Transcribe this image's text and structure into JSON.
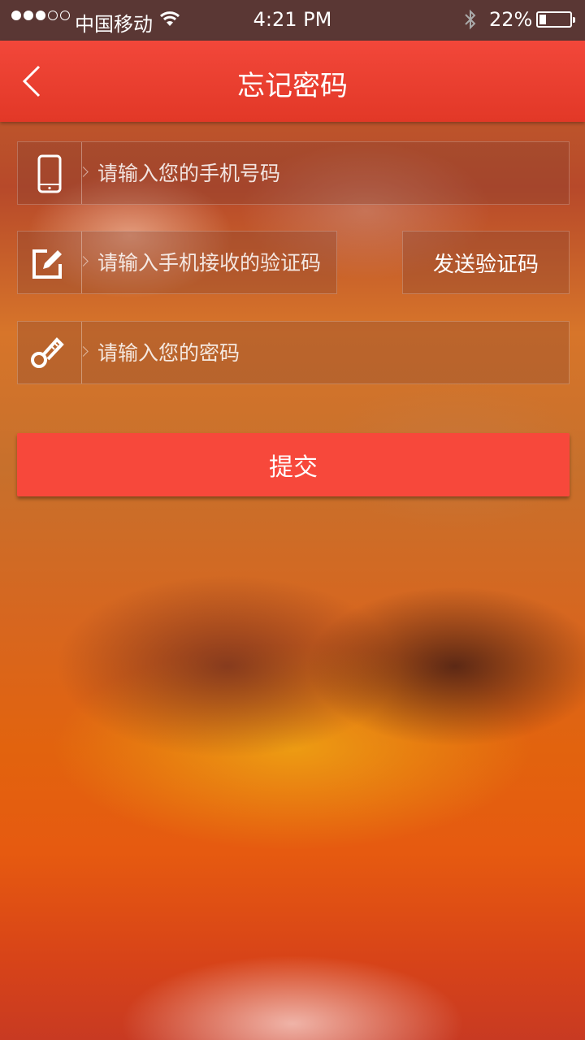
{
  "status_bar": {
    "carrier": "中国移动",
    "time": "4:21 PM",
    "battery_percent": "22%",
    "battery_level": 0.22,
    "signal_strength": 3,
    "icons": [
      "wifi-icon",
      "bluetooth-icon",
      "battery-icon"
    ]
  },
  "nav": {
    "title": "忘记密码",
    "back_icon": "chevron-left-icon"
  },
  "form": {
    "phone": {
      "placeholder": "请输入您的手机号码",
      "value": "",
      "icon": "mobile-phone-icon"
    },
    "code": {
      "placeholder": "请输入手机接收的验证码",
      "value": "",
      "icon": "edit-icon"
    },
    "send_code_label": "发送验证码",
    "password": {
      "placeholder": "请输入您的密码",
      "value": "",
      "icon": "key-icon"
    },
    "submit_label": "提交"
  },
  "colors": {
    "accent": "#f7483b",
    "nav_bar": "#e63b2b",
    "status_bar": "#5a3734"
  }
}
